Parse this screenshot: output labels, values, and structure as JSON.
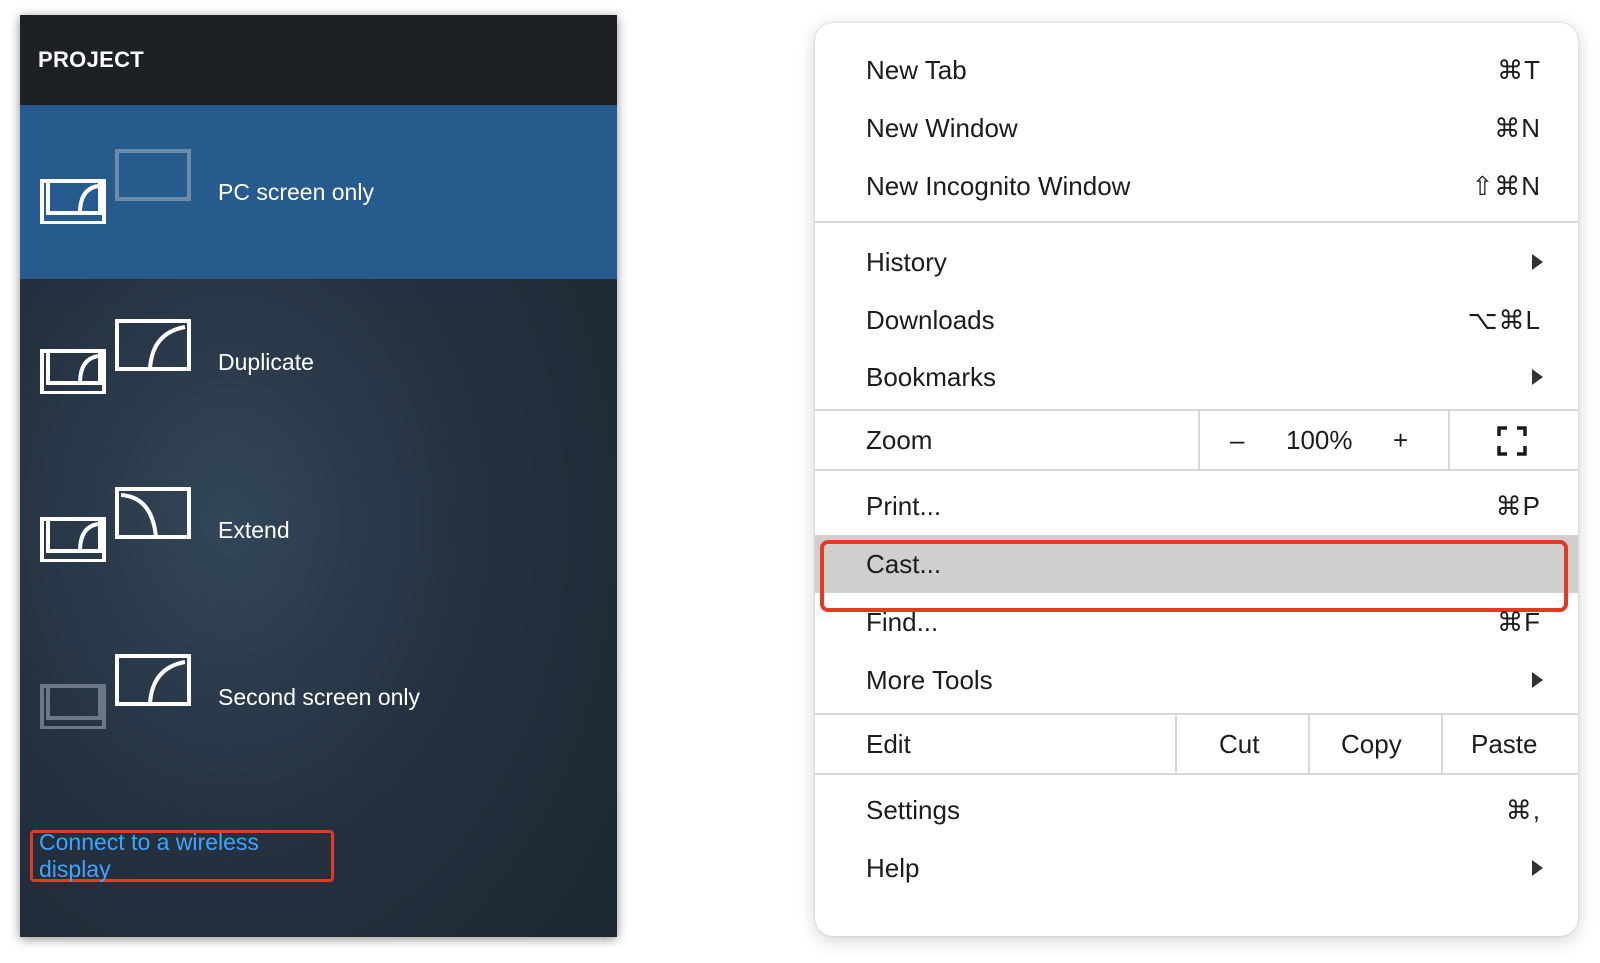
{
  "project_panel": {
    "title": "PROJECT",
    "options": [
      {
        "label": "PC screen only",
        "selected": true
      },
      {
        "label": "Duplicate",
        "selected": false
      },
      {
        "label": "Extend",
        "selected": false
      },
      {
        "label": "Second screen only",
        "selected": false
      }
    ],
    "wireless_link": "Connect to a wireless display",
    "colors": {
      "selected_bg": "#275a8d",
      "link": "#3fa4ff",
      "highlight_border": "#e53a22"
    }
  },
  "chrome_menu": {
    "group1": [
      {
        "label": "New Tab",
        "shortcut": "⌘T"
      },
      {
        "label": "New Window",
        "shortcut": "⌘N"
      },
      {
        "label": "New Incognito Window",
        "shortcut": "⇧⌘N"
      }
    ],
    "group2": [
      {
        "label": "History",
        "submenu": true
      },
      {
        "label": "Downloads",
        "shortcut": "⌥⌘L"
      },
      {
        "label": "Bookmarks",
        "submenu": true
      }
    ],
    "zoom": {
      "label": "Zoom",
      "minus": "–",
      "value": "100%",
      "plus": "+",
      "fullscreen_icon": "fullscreen-icon"
    },
    "group3": [
      {
        "label": "Print...",
        "shortcut": "⌘P"
      },
      {
        "label": "Cast...",
        "highlighted": true
      },
      {
        "label": "Find...",
        "shortcut": "⌘F"
      },
      {
        "label": "More Tools",
        "submenu": true
      }
    ],
    "edit": {
      "label": "Edit",
      "cut": "Cut",
      "copy": "Copy",
      "paste": "Paste"
    },
    "group4": [
      {
        "label": "Settings",
        "shortcut": "⌘,"
      },
      {
        "label": "Help",
        "submenu": true
      }
    ]
  }
}
